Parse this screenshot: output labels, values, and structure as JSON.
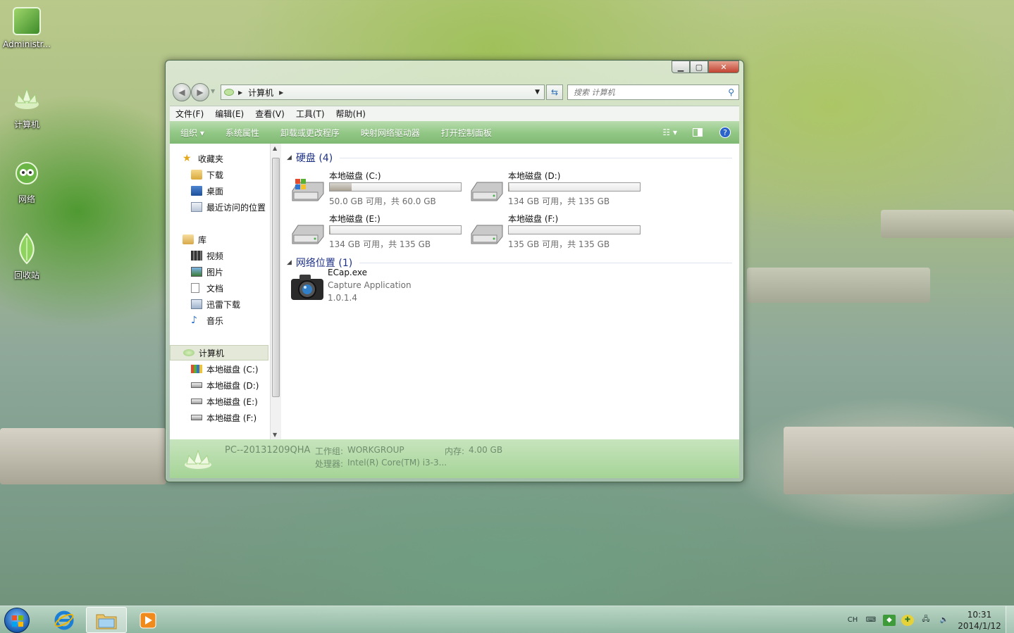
{
  "desktop": {
    "icons": [
      {
        "label": "Administr..."
      },
      {
        "label": "计算机"
      },
      {
        "label": "网络"
      },
      {
        "label": "回收站"
      }
    ]
  },
  "window": {
    "breadcrumb": "计算机",
    "search_placeholder": "搜索 计算机",
    "menu": [
      "文件(F)",
      "编辑(E)",
      "查看(V)",
      "工具(T)",
      "帮助(H)"
    ],
    "commands": [
      "组织 ▾",
      "系统属性",
      "卸载或更改程序",
      "映射网络驱动器",
      "打开控制面板"
    ],
    "nav": {
      "favorites": "收藏夹",
      "downloads": "下载",
      "desktop": "桌面",
      "recent": "最近访问的位置",
      "libraries": "库",
      "videos": "视频",
      "pictures": "图片",
      "documents": "文档",
      "thunder": "迅雷下载",
      "music": "音乐",
      "computer": "计算机",
      "drive_c": "本地磁盘 (C:)",
      "drive_d": "本地磁盘 (D:)",
      "drive_e": "本地磁盘 (E:)",
      "drive_f": "本地磁盘 (F:)"
    },
    "groups": {
      "hard_disks": "硬盘 (4)",
      "network": "网络位置 (1)"
    },
    "drives": [
      {
        "name": "本地磁盘 (C:)",
        "info": "50.0 GB 可用，共 60.0 GB",
        "used_fraction": 0.167
      },
      {
        "name": "本地磁盘 (D:)",
        "info": "134 GB 可用，共 135 GB",
        "used_fraction": 0.007
      },
      {
        "name": "本地磁盘 (E:)",
        "info": "134 GB 可用，共 135 GB",
        "used_fraction": 0.007
      },
      {
        "name": "本地磁盘 (F:)",
        "info": "135 GB 可用，共 135 GB",
        "used_fraction": 0.0
      }
    ],
    "network_item": {
      "name": "ECap.exe",
      "description": "Capture Application",
      "version": "1.0.1.4"
    },
    "details": {
      "pc_name": "PC--20131209QHA",
      "workgroup_label": "工作组:",
      "workgroup": "WORKGROUP",
      "memory_label": "内存:",
      "memory": "4.00 GB",
      "cpu_label": "处理器:",
      "cpu": "Intel(R) Core(TM) i3-3..."
    }
  },
  "taskbar": {
    "lang": "CH",
    "time": "10:31",
    "date": "2014/1/12"
  },
  "colors": {
    "accent_green": "#8ec481",
    "group_header_blue": "#1e3287",
    "close_red": "#c14331"
  }
}
